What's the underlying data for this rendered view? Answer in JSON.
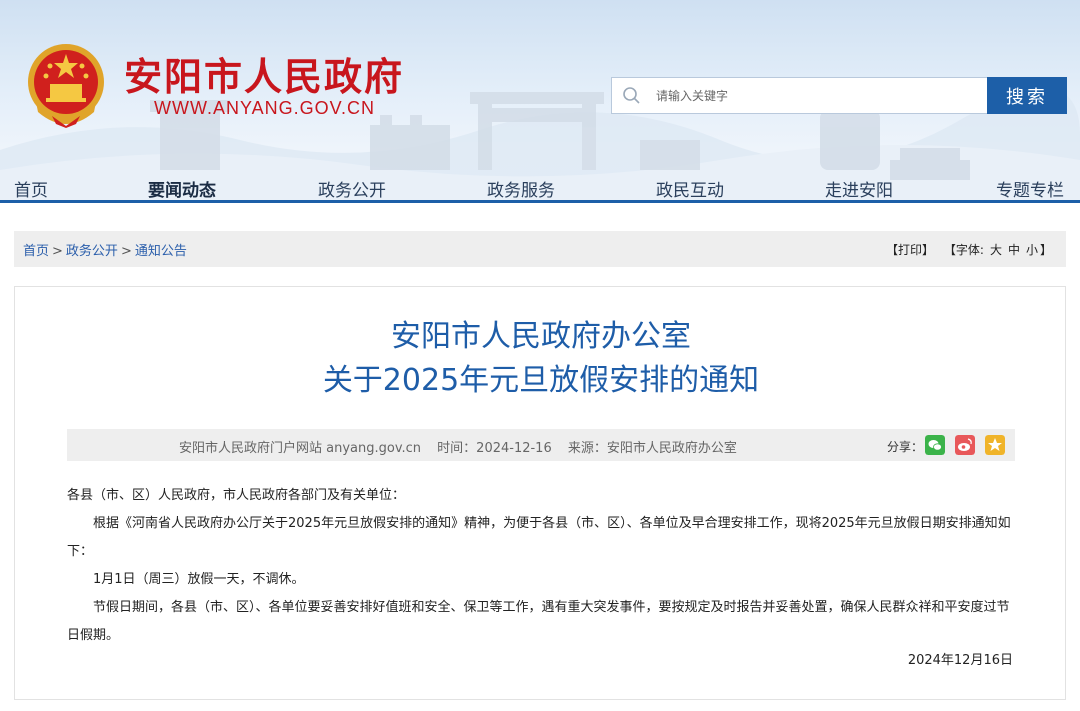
{
  "header": {
    "site_title": "安阳市人民政府",
    "site_url": "WWW.ANYANG.GOV.CN",
    "search_placeholder": "请输入关键字",
    "search_button": "搜索"
  },
  "nav": {
    "items": [
      {
        "label": "首页",
        "active": false
      },
      {
        "label": "要闻动态",
        "active": true
      },
      {
        "label": "政务公开",
        "active": false
      },
      {
        "label": "政务服务",
        "active": false
      },
      {
        "label": "政民互动",
        "active": false
      },
      {
        "label": "走进安阳",
        "active": false
      },
      {
        "label": "专题专栏",
        "active": false
      }
    ]
  },
  "breadcrumb": {
    "items": [
      "首页",
      "政务公开",
      "通知公告"
    ],
    "separator": ">"
  },
  "tools": {
    "print": "【打印】",
    "font_prefix": "【字体:",
    "font_large": "大",
    "font_medium": "中",
    "font_small": "小",
    "font_suffix": "】"
  },
  "article": {
    "title_line1": "安阳市人民政府办公室",
    "title_line2": "关于2025年元旦放假安排的通知",
    "meta_site": "安阳市人民政府门户网站 anyang.gov.cn",
    "meta_time": "时间：2024-12-16",
    "meta_source": "来源：安阳市人民政府办公室",
    "share_label": "分享：",
    "salutation": "各县（市、区）人民政府，市人民政府各部门及有关单位：",
    "para1": "根据《河南省人民政府办公厅关于2025年元旦放假安排的通知》精神，为便于各县（市、区）、各单位及早合理安排工作，现将2025年元旦放假日期安排通知如下：",
    "para2": "1月1日（周三）放假一天，不调休。",
    "para3": "节假日期间，各县（市、区）、各单位要妥善安排好值班和安全、保卫等工作，遇有重大突发事件，要按规定及时报告并妥善处置，确保人民群众祥和平安度过节日假期。",
    "date": "2024年12月16日"
  },
  "colors": {
    "brand_red": "#c8161d",
    "brand_blue": "#1d5fa8",
    "title_blue": "#1e5da8",
    "wechat_green": "#3bb34a",
    "weibo_red": "#e8585a",
    "favorite_yellow": "#f0b42a"
  },
  "icons": {
    "emblem": "national-emblem-icon",
    "search": "search-icon",
    "share_wechat": "wechat-icon",
    "share_weibo": "weibo-icon",
    "share_favorite": "star-icon"
  }
}
